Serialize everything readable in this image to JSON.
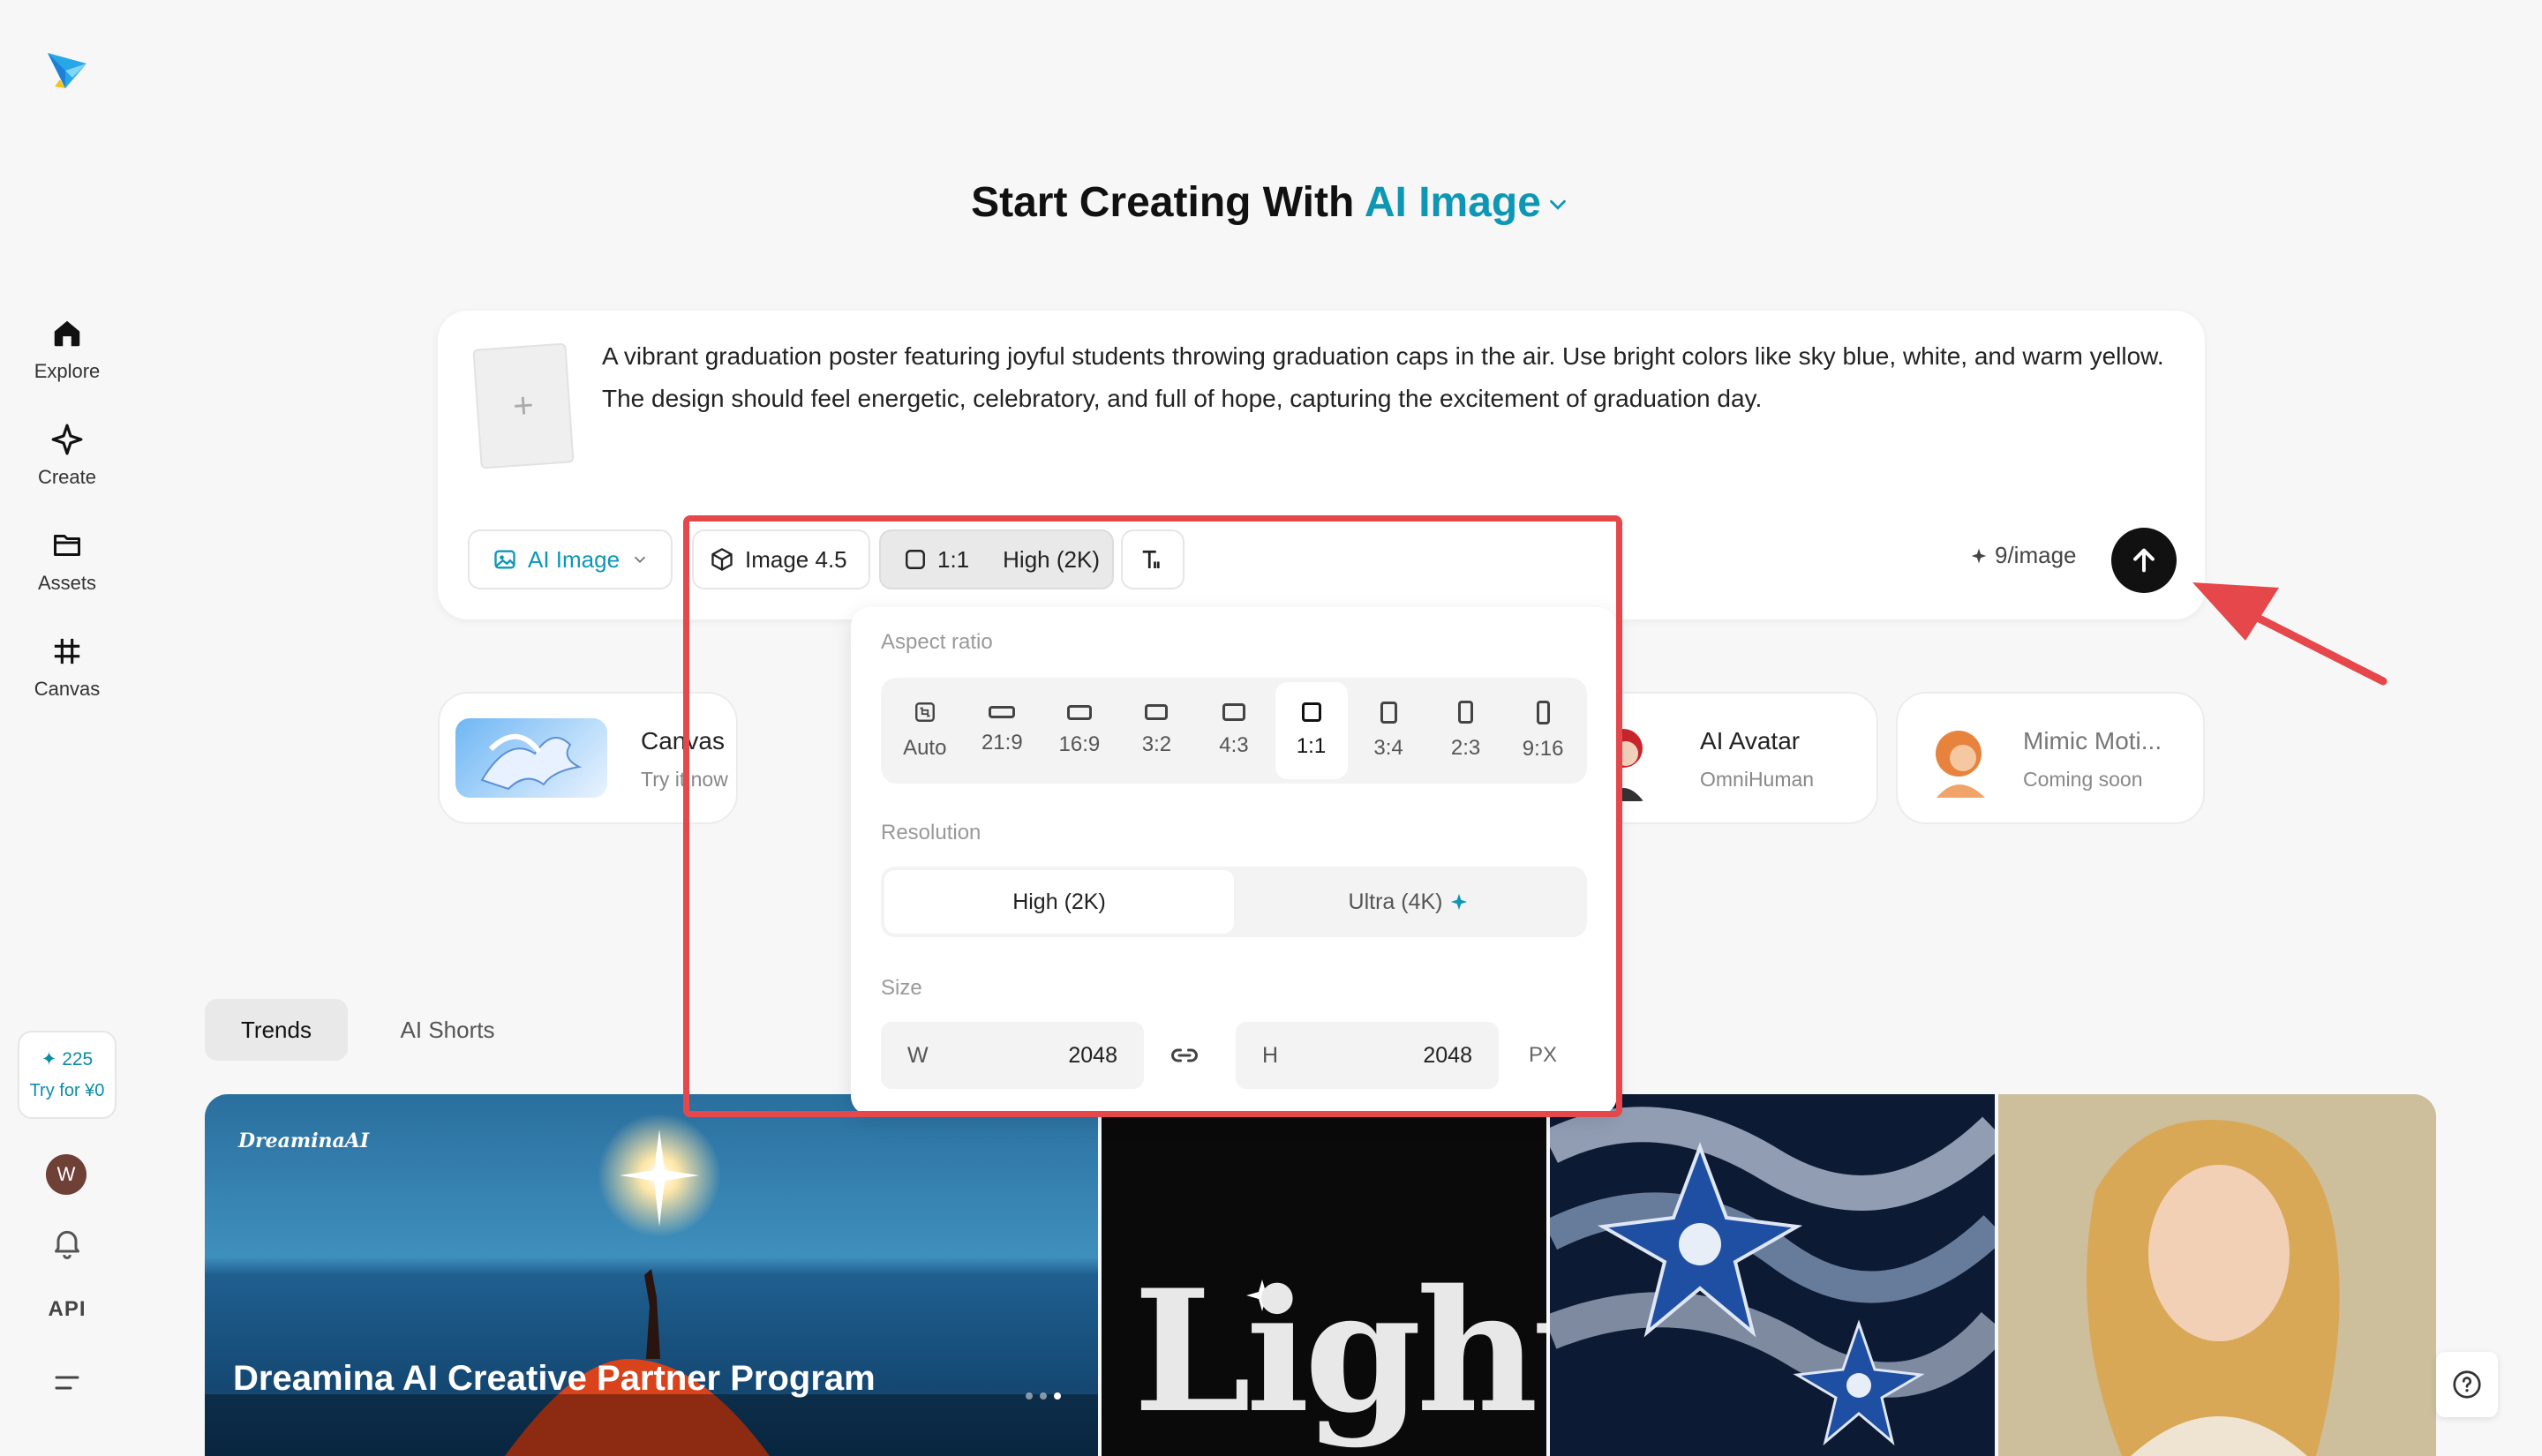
{
  "sidebar": {
    "logo_icon": "dreamina-logo",
    "items": [
      {
        "label": "Explore",
        "icon": "home-icon"
      },
      {
        "label": "Create",
        "icon": "sparkle-icon"
      },
      {
        "label": "Assets",
        "icon": "folder-icon"
      },
      {
        "label": "Canvas",
        "icon": "grid-icon"
      }
    ],
    "credits": {
      "count": "✦ 225",
      "cta": "Try for ¥0"
    },
    "avatar_initial": "W",
    "api_label": "API"
  },
  "hero": {
    "title_prefix": "Start Creating With",
    "title_accent": "AI Image"
  },
  "prompt": {
    "text": "A vibrant graduation poster featuring joyful students throwing graduation caps in the air. Use bright colors like sky blue, white, and warm yellow. The design should feel energetic, celebratory, and full of hope, capturing the excitement of graduation day.",
    "upload_symbol": "+",
    "mode_label": "AI Image",
    "model_label": "Image 4.5",
    "ratio_label": "1:1",
    "quality_label": "High (2K)",
    "cost_label": "9/image"
  },
  "features": [
    {
      "title": "Canvas",
      "subtitle": "Try it now"
    },
    {
      "title": "AI Avatar",
      "subtitle": "OmniHuman"
    },
    {
      "title": "Mimic Moti...",
      "subtitle": "Coming soon"
    }
  ],
  "popover": {
    "aspect_label": "Aspect ratio",
    "ratios": [
      {
        "label": "Auto",
        "selected": false
      },
      {
        "label": "21:9",
        "selected": false
      },
      {
        "label": "16:9",
        "selected": false
      },
      {
        "label": "3:2",
        "selected": false
      },
      {
        "label": "4:3",
        "selected": false
      },
      {
        "label": "1:1",
        "selected": true
      },
      {
        "label": "3:4",
        "selected": false
      },
      {
        "label": "2:3",
        "selected": false
      },
      {
        "label": "9:16",
        "selected": false
      }
    ],
    "resolution_label": "Resolution",
    "resolutions": [
      {
        "label": "High (2K)",
        "selected": true
      },
      {
        "label": "Ultra (4K)",
        "selected": false
      }
    ],
    "size_label": "Size",
    "width_label": "W",
    "width_value": "2048",
    "height_label": "H",
    "height_value": "2048",
    "unit": "PX"
  },
  "tabs": [
    {
      "label": "Trends",
      "selected": true
    },
    {
      "label": "AI Shorts",
      "selected": false
    }
  ],
  "gallery": {
    "banner_brand": "DreaminaAI",
    "banner_title": "Dreamina AI Creative Partner Program",
    "light_text": "Light"
  },
  "colors": {
    "accent": "#0e97b5",
    "highlight_red": "#e5474a",
    "background": "#f7f7f8"
  }
}
